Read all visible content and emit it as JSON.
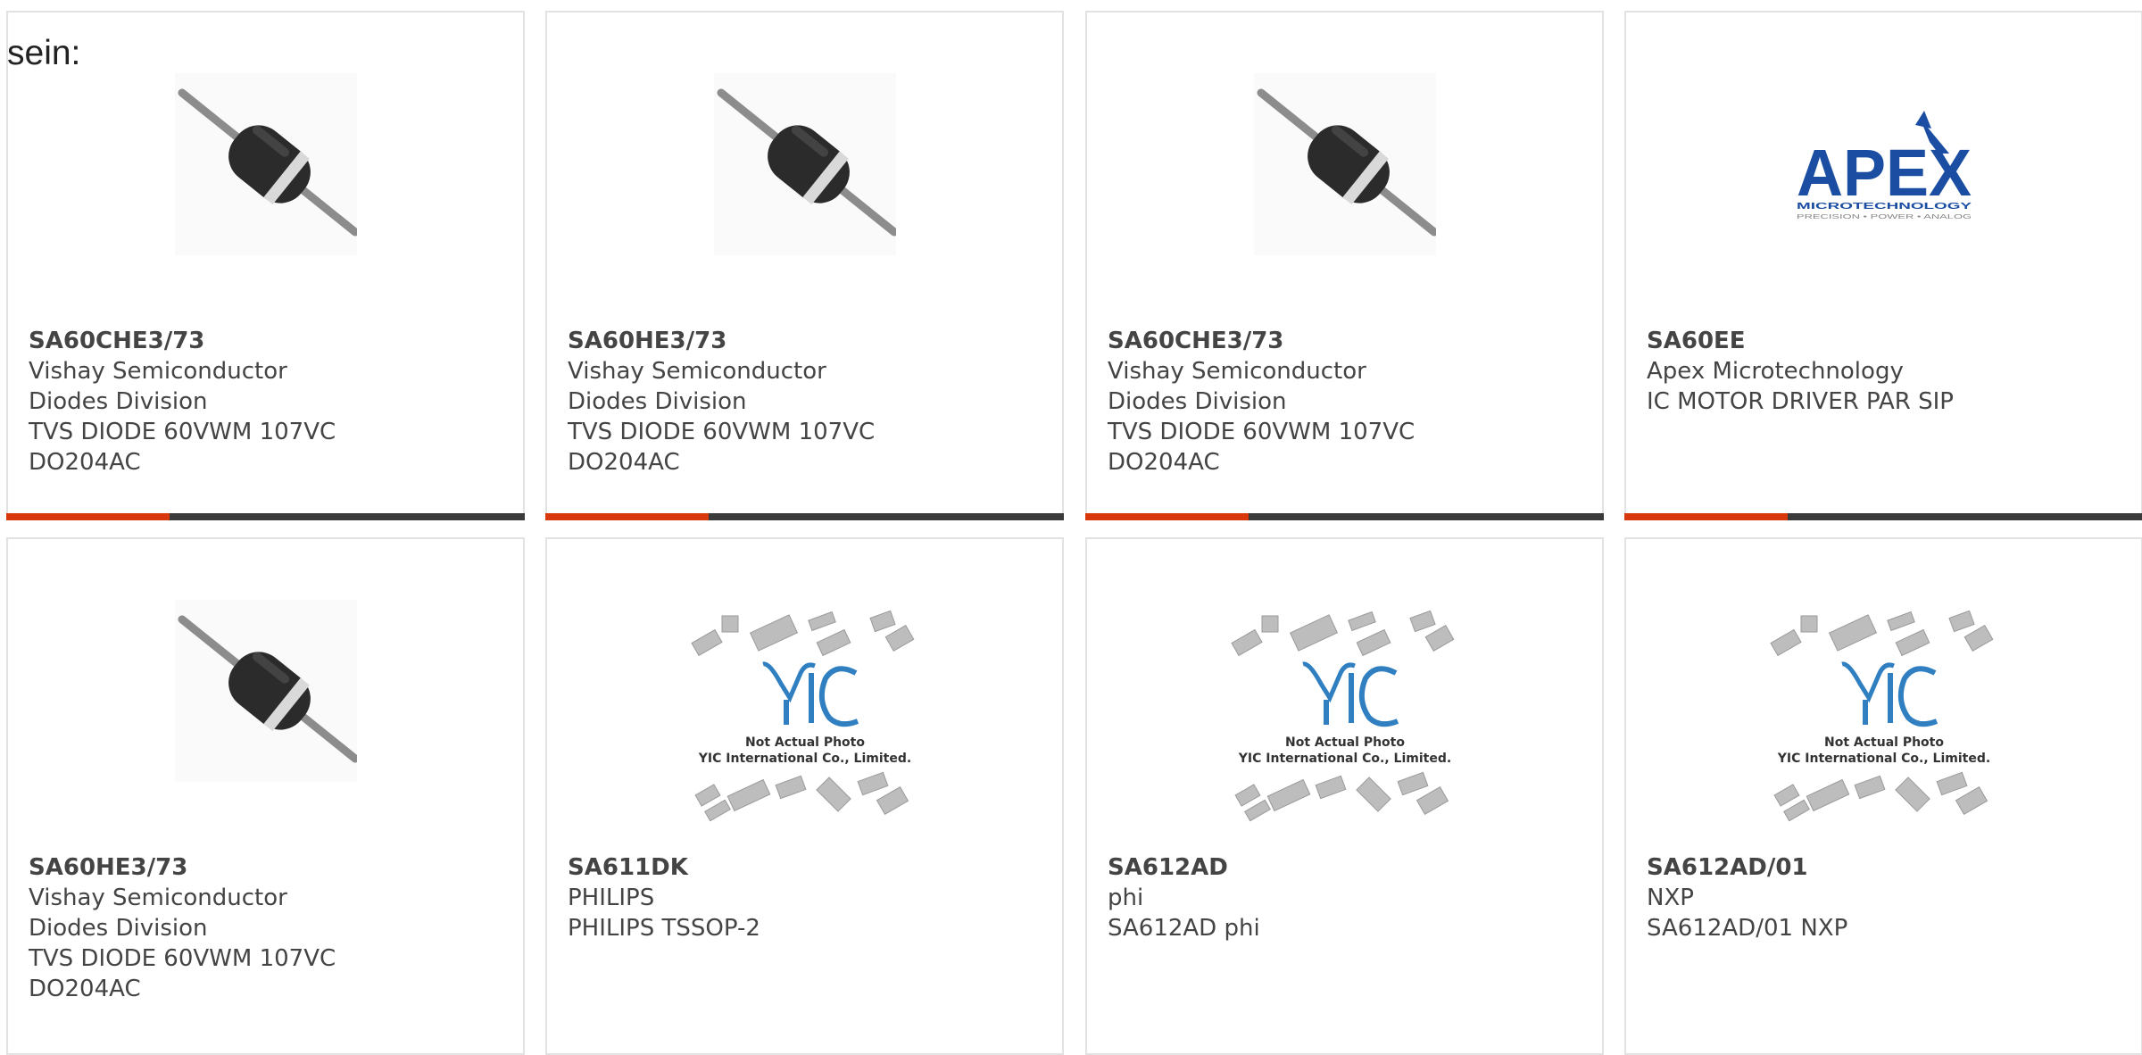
{
  "lead_text": "sein:",
  "products": [
    {
      "part": "SA60CHE3/73",
      "manufacturer": "Vishay Semiconductor Diodes Division",
      "description": "TVS DIODE 60VWM 107VC DO204AC",
      "image": "diode"
    },
    {
      "part": "SA60HE3/73",
      "manufacturer": "Vishay Semiconductor Diodes Division",
      "description": "TVS DIODE 60VWM 107VC DO204AC",
      "image": "diode"
    },
    {
      "part": "SA60CHE3/73",
      "manufacturer": "Vishay Semiconductor Diodes Division",
      "description": "TVS DIODE 60VWM 107VC DO204AC",
      "image": "diode"
    },
    {
      "part": "SA60EE",
      "manufacturer": "Apex Microtechnology",
      "description": "IC MOTOR DRIVER PAR SIP",
      "image": "apex-logo"
    },
    {
      "part": "SA60HE3/73",
      "manufacturer": "Vishay Semiconductor Diodes Division",
      "description": "TVS DIODE 60VWM 107VC DO204AC",
      "image": "diode"
    },
    {
      "part": "SA611DK",
      "manufacturer": "PHILIPS",
      "description": "PHILIPS TSSOP-2",
      "image": "yic-placeholder"
    },
    {
      "part": "SA612AD",
      "manufacturer": "phi",
      "description": "SA612AD phi",
      "image": "yic-placeholder"
    },
    {
      "part": "SA612AD/01",
      "manufacturer": "NXP",
      "description": "SA612AD/01 NXP",
      "image": "yic-placeholder"
    }
  ],
  "apex_logo": {
    "word": "APEX",
    "sub1": "MICROTECHNOLOGY",
    "sub2": "PRECISION • POWER • ANALOG"
  },
  "placeholder": {
    "line1": "Not Actual Photo",
    "line2": "YIC International Co., Limited."
  },
  "colors": {
    "accent": "#d7390c",
    "bar": "#3a3a3a",
    "apex_blue": "#1b4ea3",
    "yic_blue": "#2f7fc1"
  }
}
